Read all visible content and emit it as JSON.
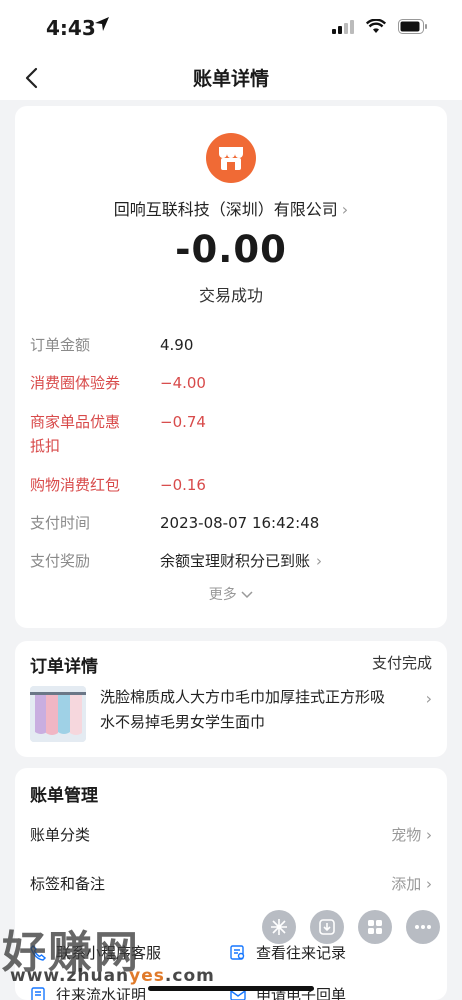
{
  "status_bar": {
    "time": "4:43"
  },
  "nav": {
    "title": "账单详情"
  },
  "merchant": {
    "name": "回响互联科技（深圳）有限公司",
    "amount": "-0.00",
    "status": "交易成功"
  },
  "details": [
    {
      "label": "订单金额",
      "value": "4.90"
    },
    {
      "label": "消费圈体验券",
      "value": "−4.00"
    },
    {
      "label_line1": "商家单品优惠",
      "label_line2": "抵扣",
      "value": "−0.74"
    },
    {
      "label": "购物消费红包",
      "value": "−0.16"
    },
    {
      "label": "支付时间",
      "value": "2023-08-07 16:42:48"
    },
    {
      "label": "支付奖励",
      "value": "余额宝理财积分已到账"
    }
  ],
  "more_label": "更多",
  "order": {
    "title": "订单详情",
    "status": "支付完成",
    "product_line1": "洗脸棉质成人大方巾毛巾加厚挂式正方形吸",
    "product_line2": "水不易掉毛男女学生面巾"
  },
  "manage": {
    "title": "账单管理",
    "category_label": "账单分类",
    "category_value": "宠物",
    "tag_label": "标签和备注",
    "tag_value": "添加"
  },
  "links": {
    "contact": "联系小程序客服",
    "history": "查看往来记录",
    "statement": "往来流水证明",
    "receipt": "申请电子回单"
  },
  "watermark": {
    "text": "好赚网",
    "url_prefix": "www.zhuan",
    "url_highlight": "yes",
    "url_suffix": ".com"
  },
  "colors": {
    "accent_red": "#d84a4a",
    "shop_logo": "#f06a35"
  }
}
